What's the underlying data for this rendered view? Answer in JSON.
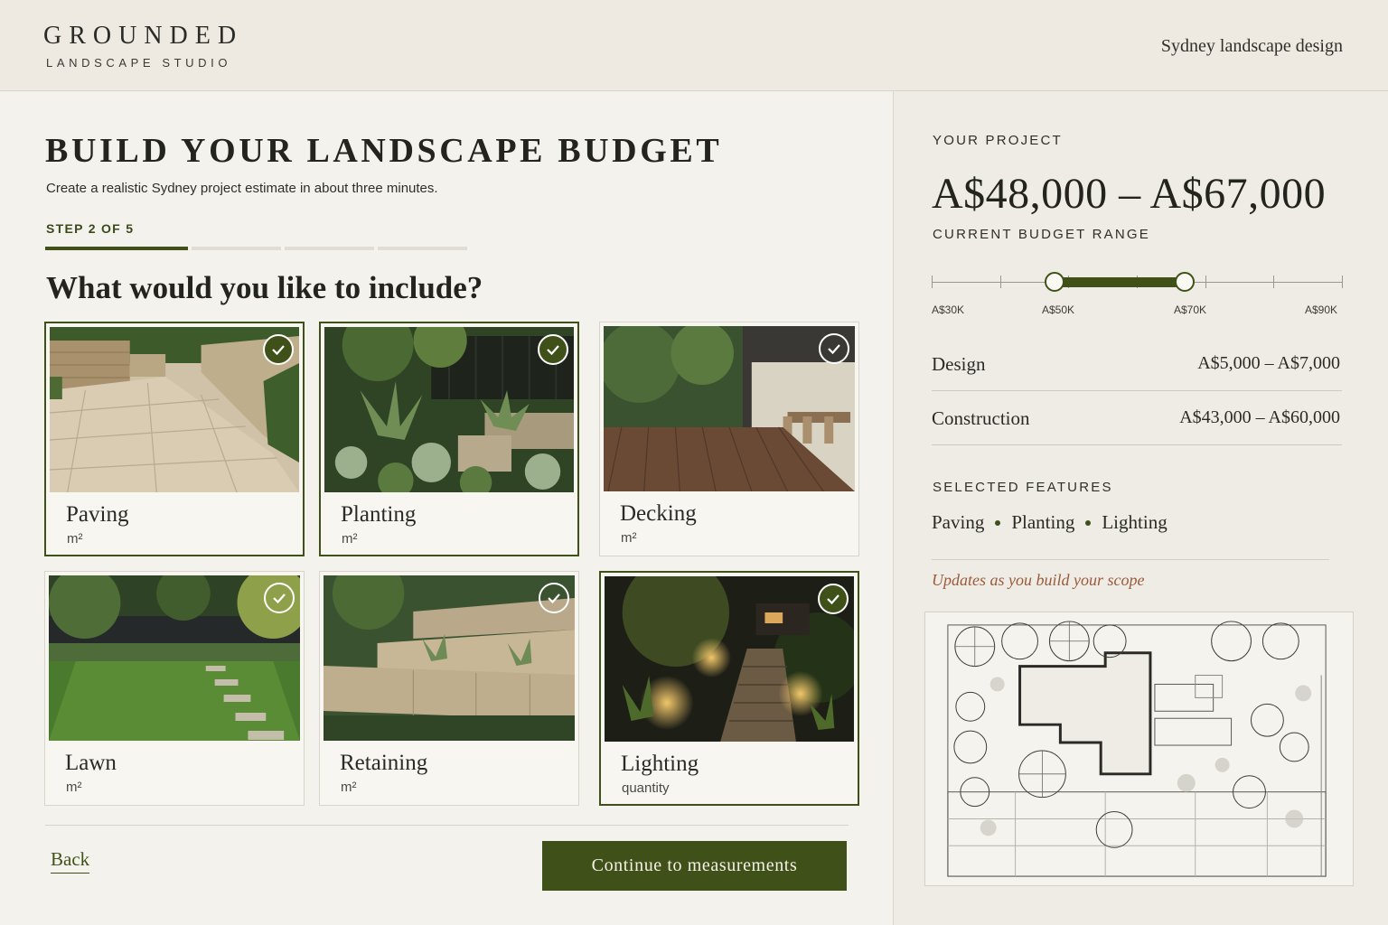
{
  "header": {
    "brand_name": "GROUNDED",
    "brand_sub": "LANDSCAPE STUDIO",
    "tagline": "Sydney landscape design"
  },
  "main": {
    "title": "BUILD YOUR LANDSCAPE BUDGET",
    "subtitle": "Create a realistic Sydney project estimate in about three minutes.",
    "step_label": "STEP 2 OF 5",
    "step_current": 2,
    "step_total": 5,
    "question": "What would you like to include?",
    "options": [
      {
        "name": "Paving",
        "unit": "m²",
        "selected": true
      },
      {
        "name": "Planting",
        "unit": "m²",
        "selected": true
      },
      {
        "name": "Decking",
        "unit": "m²",
        "selected": false
      },
      {
        "name": "Lawn",
        "unit": "m²",
        "selected": false
      },
      {
        "name": "Retaining",
        "unit": "m²",
        "selected": false
      },
      {
        "name": "Lighting",
        "unit": "quantity",
        "selected": true
      }
    ],
    "back_label": "Back",
    "continue_label": "Continue to measurements"
  },
  "sidebar": {
    "project_label": "YOUR PROJECT",
    "price_range": "A$48,000 – A$67,000",
    "budget_label": "CURRENT BUDGET RANGE",
    "slider": {
      "min": 30000,
      "max": 90000,
      "low": 48000,
      "high": 67000,
      "tick_labels": [
        "A$30K",
        "A$50K",
        "A$70K",
        "A$90K"
      ]
    },
    "breakdown": [
      {
        "label": "Design",
        "value": "A$5,000 – A$7,000"
      },
      {
        "label": "Construction",
        "value": "A$43,000 – A$60,000"
      }
    ],
    "features_label": "SELECTED FEATURES",
    "features": [
      "Paving",
      "Planting",
      "Lighting"
    ],
    "note": "Updates as you build your scope"
  },
  "colors": {
    "accent": "#3f5119",
    "note": "#9a5a3c",
    "background": "#f4f2ec"
  }
}
